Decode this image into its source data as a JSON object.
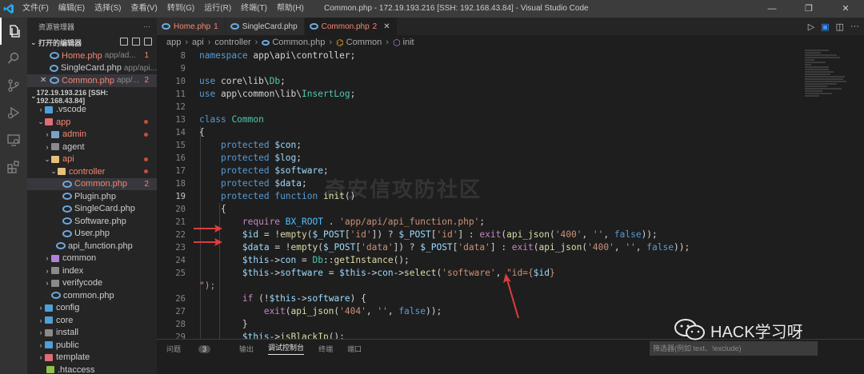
{
  "window": {
    "title": "Common.php - 172.19.193.216 [SSH: 192.168.43.84] - Visual Studio Code",
    "menu": [
      "文件(F)",
      "编辑(E)",
      "选择(S)",
      "查看(V)",
      "转到(G)",
      "运行(R)",
      "终端(T)",
      "帮助(H)"
    ],
    "controls": [
      "—",
      "❐",
      "✕"
    ]
  },
  "sidebar": {
    "header": "资源管理器",
    "open_editors_title": "打开的编辑器",
    "open_editors": [
      {
        "name": "Home.php",
        "path": "app/ad...",
        "badge": "1"
      },
      {
        "name": "SingleCard.php",
        "path": "app/api...",
        "badge": ""
      },
      {
        "name": "Common.php",
        "path": "app/...",
        "badge": "2"
      }
    ],
    "workspace_title": "172.19.193.216 [SSH: 192.168.43.84]",
    "tree": [
      {
        "name": ".vscode",
        "type": "folder"
      },
      {
        "name": "app",
        "type": "folder"
      },
      {
        "name": "admin",
        "type": "folder"
      },
      {
        "name": "agent",
        "type": "folder"
      },
      {
        "name": "api",
        "type": "folder"
      },
      {
        "name": "controller",
        "type": "folder"
      },
      {
        "name": "Common.php",
        "badge": "2"
      },
      {
        "name": "Plugin.php"
      },
      {
        "name": "SingleCard.php"
      },
      {
        "name": "Software.php"
      },
      {
        "name": "User.php"
      },
      {
        "name": "api_function.php"
      },
      {
        "name": "common",
        "type": "folder"
      },
      {
        "name": "index",
        "type": "folder"
      },
      {
        "name": "verifycode",
        "type": "folder"
      },
      {
        "name": "common.php"
      },
      {
        "name": "config",
        "type": "folder"
      },
      {
        "name": "core",
        "type": "folder"
      },
      {
        "name": "install",
        "type": "folder"
      },
      {
        "name": "public",
        "type": "folder"
      },
      {
        "name": "template",
        "type": "folder"
      },
      {
        "name": ".htaccess"
      }
    ]
  },
  "tabs": [
    {
      "label": "Home.php",
      "badge": "1"
    },
    {
      "label": "SingleCard.php",
      "badge": ""
    },
    {
      "label": "Common.php",
      "badge": "2"
    }
  ],
  "breadcrumb": [
    "app",
    "api",
    "controller",
    "Common.php",
    "Common",
    "init"
  ],
  "editor": {
    "line_numbers": [
      "8",
      "9",
      "10",
      "11",
      "12",
      "13",
      "14",
      "15",
      "16",
      "17",
      "18",
      "19",
      "20",
      "21",
      "22",
      "23",
      "24",
      "25",
      "",
      "26",
      "27",
      "28",
      "29",
      "30"
    ],
    "watermark": "奇安信攻防社区"
  },
  "panel": {
    "tabs": [
      "问题",
      "输出",
      "调试控制台",
      "终端",
      "端口"
    ],
    "problems_count": "3",
    "filter_placeholder": "筛选器(例如 text、!exclude)"
  },
  "branding": {
    "wechat_account": "HACK学习呀"
  },
  "colors": {
    "accent": "#007acc",
    "arrow": "#e03c3c",
    "error": "#f48771"
  }
}
